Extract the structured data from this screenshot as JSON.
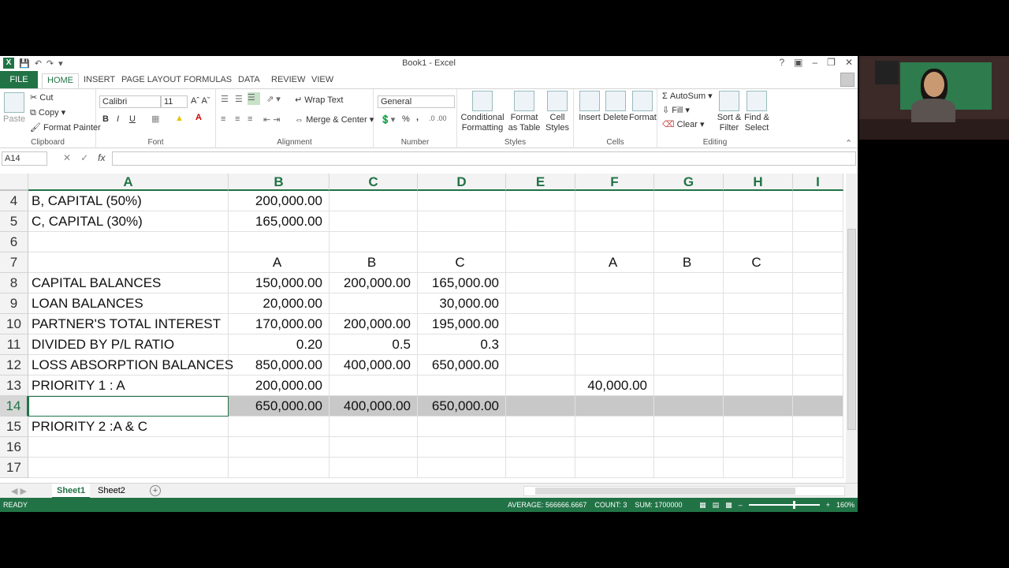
{
  "app": {
    "title": "Book1 - Excel",
    "file_tab": "FILE",
    "tabs": [
      "HOME",
      "INSERT",
      "PAGE LAYOUT",
      "FORMULAS",
      "DATA",
      "REVIEW",
      "VIEW"
    ],
    "help": "?",
    "accent": "#217346"
  },
  "ribbon": {
    "clipboard": {
      "label": "Clipboard",
      "paste": "Paste",
      "cut": "Cut",
      "copy": "Copy",
      "format_painter": "Format Painter"
    },
    "font": {
      "label": "Font",
      "family": "Calibri",
      "size": "11",
      "bold": "B",
      "italic": "I",
      "underline": "U"
    },
    "alignment": {
      "label": "Alignment",
      "wrap": "Wrap Text",
      "merge": "Merge & Center"
    },
    "number": {
      "label": "Number",
      "format": "General",
      "percent": "%",
      "comma": ","
    },
    "styles": {
      "label": "Styles",
      "conditional": "Conditional Formatting",
      "format_table": "Format as Table",
      "cell_styles": "Cell Styles"
    },
    "cells": {
      "label": "Cells",
      "insert": "Insert",
      "delete": "Delete",
      "format": "Format"
    },
    "editing": {
      "label": "Editing",
      "autosum": "AutoSum",
      "fill": "Fill",
      "clear": "Clear",
      "sort": "Sort & Filter",
      "find": "Find & Select"
    }
  },
  "formula_bar": {
    "name_box": "A14",
    "fx": "fx",
    "value": ""
  },
  "grid": {
    "columns": [
      "A",
      "B",
      "C",
      "D",
      "E",
      "F",
      "G",
      "H",
      "I"
    ],
    "selected_row": "14",
    "rows": [
      {
        "n": "4",
        "A": "B, CAPITAL (50%)",
        "B": "200,000.00",
        "C": "",
        "D": "",
        "E": "",
        "F": "",
        "G": "",
        "H": ""
      },
      {
        "n": "5",
        "A": "C, CAPITAL (30%)",
        "B": "165,000.00",
        "C": "",
        "D": "",
        "E": "",
        "F": "",
        "G": "",
        "H": ""
      },
      {
        "n": "6",
        "A": "",
        "B": "",
        "C": "",
        "D": "",
        "E": "",
        "F": "",
        "G": "",
        "H": ""
      },
      {
        "n": "7",
        "A": "",
        "B": "A",
        "C": "B",
        "D": "C",
        "E": "",
        "F": "A",
        "G": "B",
        "H": "C"
      },
      {
        "n": "8",
        "A": "CAPITAL BALANCES",
        "B": "150,000.00",
        "C": "200,000.00",
        "D": "165,000.00",
        "E": "",
        "F": "",
        "G": "",
        "H": ""
      },
      {
        "n": "9",
        "A": "LOAN BALANCES",
        "B": "20,000.00",
        "C": "",
        "D": "30,000.00",
        "E": "",
        "F": "",
        "G": "",
        "H": ""
      },
      {
        "n": "10",
        "A": "PARTNER'S TOTAL INTEREST",
        "B": "170,000.00",
        "C": "200,000.00",
        "D": "195,000.00",
        "E": "",
        "F": "",
        "G": "",
        "H": ""
      },
      {
        "n": "11",
        "A": "DIVIDED BY P/L RATIO",
        "B": "0.20",
        "C": "0.5",
        "D": "0.3",
        "E": "",
        "F": "",
        "G": "",
        "H": ""
      },
      {
        "n": "12",
        "A": "LOSS ABSORPTION BALANCES",
        "B": "850,000.00",
        "C": "400,000.00",
        "D": "650,000.00",
        "E": "",
        "F": "",
        "G": "",
        "H": ""
      },
      {
        "n": "13",
        "A": "PRIORITY 1 : A",
        "B": "200,000.00",
        "C": "",
        "D": "",
        "E": "",
        "F": "40,000.00",
        "G": "",
        "H": ""
      },
      {
        "n": "14",
        "A": "",
        "B": "650,000.00",
        "C": "400,000.00",
        "D": "650,000.00",
        "E": "",
        "F": "",
        "G": "",
        "H": ""
      },
      {
        "n": "15",
        "A": "PRIORITY 2 :A & C",
        "B": "",
        "C": "",
        "D": "",
        "E": "",
        "F": "",
        "G": "",
        "H": ""
      },
      {
        "n": "16",
        "A": "",
        "B": "",
        "C": "",
        "D": "",
        "E": "",
        "F": "",
        "G": "",
        "H": ""
      },
      {
        "n": "17",
        "A": "",
        "B": "",
        "C": "",
        "D": "",
        "E": "",
        "F": "",
        "G": "",
        "H": ""
      }
    ]
  },
  "sheets": [
    "Sheet1",
    "Sheet2"
  ],
  "status": {
    "ready": "READY",
    "average": "AVERAGE: 566666.6667",
    "count": "COUNT: 3",
    "sum": "SUM: 1700000",
    "zoom": "160%",
    "zoom_level_fraction": 0.62
  }
}
